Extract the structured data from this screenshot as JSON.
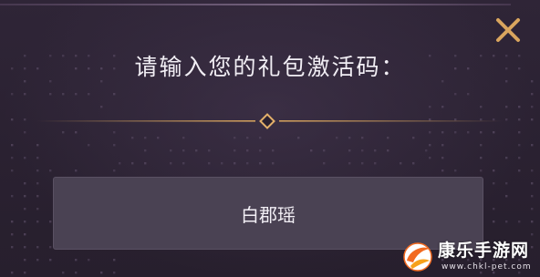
{
  "dialog": {
    "title": "请输入您的礼包激活码：",
    "code_input_value": "白郡瑶",
    "close_icon": "close-icon",
    "accent_color": "#d9a55e",
    "field_color": "#4a4253",
    "background_color": "#2a2130"
  },
  "watermark": {
    "name": "康乐手游网",
    "url": "www.chkl-pet.com"
  }
}
